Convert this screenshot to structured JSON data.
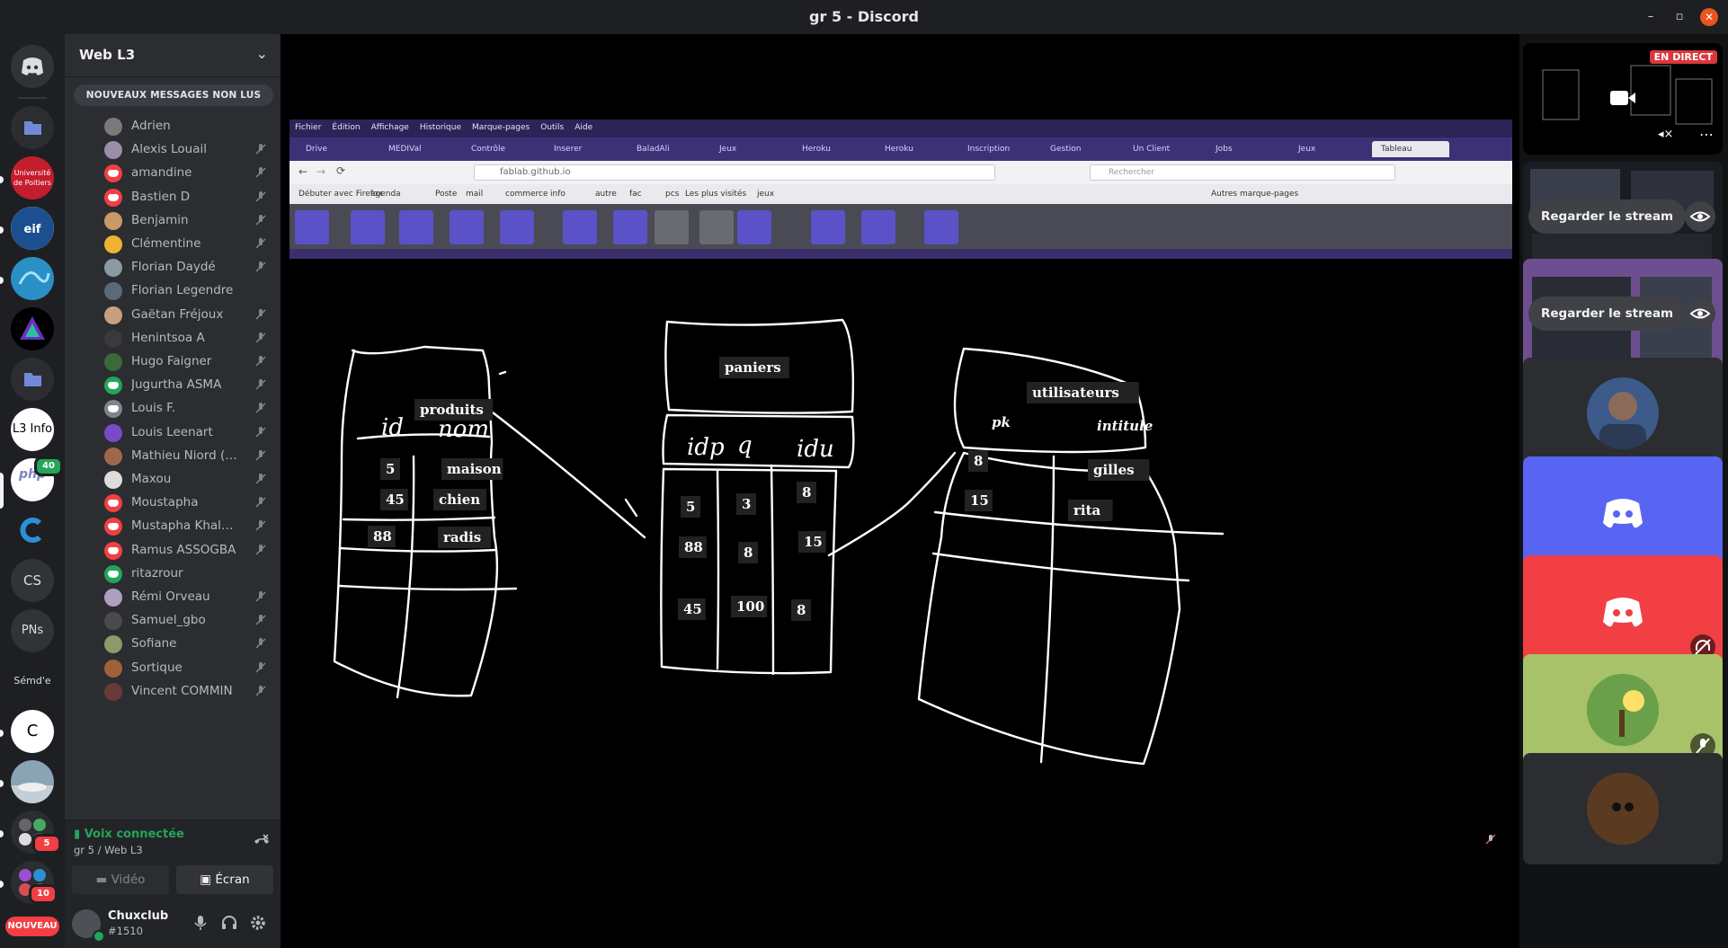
{
  "window": {
    "title": "gr 5 - Discord",
    "minimize": "–",
    "maximize": "▫",
    "close": "✕"
  },
  "servers": {
    "items": [
      {
        "label": "",
        "icon": "discord-home-icon"
      },
      {
        "label": "",
        "icon": "folder-icon"
      },
      {
        "label": "Université de Poitiers",
        "icon": "university-logo"
      },
      {
        "label": "eif",
        "icon": "eif-logo"
      },
      {
        "label": "",
        "icon": "swirl-logo"
      },
      {
        "label": "",
        "icon": "triangle-logo"
      },
      {
        "label": "",
        "icon": "folder-icon"
      },
      {
        "label": "L3 Info",
        "icon": "text-icon"
      },
      {
        "label": "php sf",
        "icon": "php-logo"
      },
      {
        "label": "",
        "icon": "c-logo"
      },
      {
        "label": "CS",
        "icon": "text-icon"
      },
      {
        "label": "PNs",
        "icon": "text-icon"
      },
      {
        "label": "Sémd'e",
        "icon": "text-icon"
      },
      {
        "label": "C",
        "icon": "c-doc-icon"
      },
      {
        "label": "",
        "icon": "photo-icon"
      },
      {
        "label": "5",
        "icon": "group-icon"
      },
      {
        "label": "10",
        "icon": "group-icon"
      }
    ],
    "new_label": "NOUVEAU",
    "badge_php": "40",
    "badge_a": "5",
    "badge_b": "10"
  },
  "guild": {
    "name": "Web L3",
    "unread_label": "NOUVEAUX MESSAGES NON LUS"
  },
  "members": [
    {
      "name": "Adrien",
      "muted": false
    },
    {
      "name": "Alexis Louail",
      "muted": true
    },
    {
      "name": "amandine",
      "muted": true
    },
    {
      "name": "Bastien D",
      "muted": true
    },
    {
      "name": "Benjamin",
      "muted": true
    },
    {
      "name": "Clémentine",
      "muted": true
    },
    {
      "name": "Florian Daydé",
      "muted": true
    },
    {
      "name": "Florian Legendre",
      "muted": false
    },
    {
      "name": "Gaëtan Fréjoux",
      "muted": true
    },
    {
      "name": "Henintsoa A",
      "muted": true
    },
    {
      "name": "Hugo Faigner",
      "muted": true
    },
    {
      "name": "Jugurtha ASMA",
      "muted": true
    },
    {
      "name": "Louis F.",
      "muted": true
    },
    {
      "name": "Louis Leenart",
      "muted": true
    },
    {
      "name": "Mathieu Niord (Bog...",
      "muted": true
    },
    {
      "name": "Maxou",
      "muted": true
    },
    {
      "name": "Moustapha",
      "muted": true
    },
    {
      "name": "Mustapha Khalouk",
      "muted": true
    },
    {
      "name": "Ramus ASSOGBA",
      "muted": true
    },
    {
      "name": "ritazrour",
      "muted": false
    },
    {
      "name": "Rémi Orveau",
      "muted": true
    },
    {
      "name": "Samuel_gbo",
      "muted": true
    },
    {
      "name": "Sofiane",
      "muted": true
    },
    {
      "name": "Sortique",
      "muted": true
    },
    {
      "name": "Vincent COMMIN",
      "muted": true
    }
  ],
  "voice": {
    "status": "Voix connectée",
    "channel": "gr 5 / Web L3",
    "video_label": "Vidéo",
    "screen_label": "Écran"
  },
  "user": {
    "name": "Chuxclub",
    "tag": "#1510"
  },
  "browser": {
    "menu": [
      "Fichier",
      "Édition",
      "Affichage",
      "Historique",
      "Marque-pages",
      "Outils",
      "Aide"
    ],
    "tabs": [
      "Drive",
      "MEDIVal",
      "Contrôle",
      "Inserer",
      "BaladAli",
      "Jeux",
      "Heroku",
      "Heroku",
      "Inscription",
      "Gestion",
      "Un Client",
      "Jobs",
      "Jeux",
      "Tableau"
    ],
    "url": "fablab.github.io",
    "search_placeholder": "Rechercher",
    "bookmarks": [
      "Débuter avec Firefox",
      "agenda",
      "Poste",
      "mail",
      "commerce",
      "info",
      "autre",
      "fac",
      "pcs",
      "Les plus visités",
      "jeux",
      "Autres marque-pages"
    ]
  },
  "whiteboard": {
    "tables": [
      {
        "title": "produits",
        "cols": [
          "id",
          "nom"
        ],
        "rows": [
          [
            "5",
            "maison"
          ],
          [
            "45",
            "chien"
          ],
          [
            "88",
            "radis"
          ]
        ]
      },
      {
        "title": "paniers",
        "cols": [
          "idp",
          "q",
          "idu"
        ],
        "rows": [
          [
            "5",
            "3",
            "8"
          ],
          [
            "88",
            "8",
            "15"
          ],
          [
            "45",
            "100",
            "8"
          ]
        ]
      },
      {
        "title": "utilisateurs",
        "cols": [
          "pk",
          "intitule"
        ],
        "rows": [
          [
            "8",
            "gilles"
          ],
          [
            "15",
            "rita"
          ]
        ]
      }
    ]
  },
  "right_panel": {
    "live_label": "EN DIRECT",
    "watch_label": "Regarder le stream",
    "watch_label_2": "Regarder le stream"
  }
}
